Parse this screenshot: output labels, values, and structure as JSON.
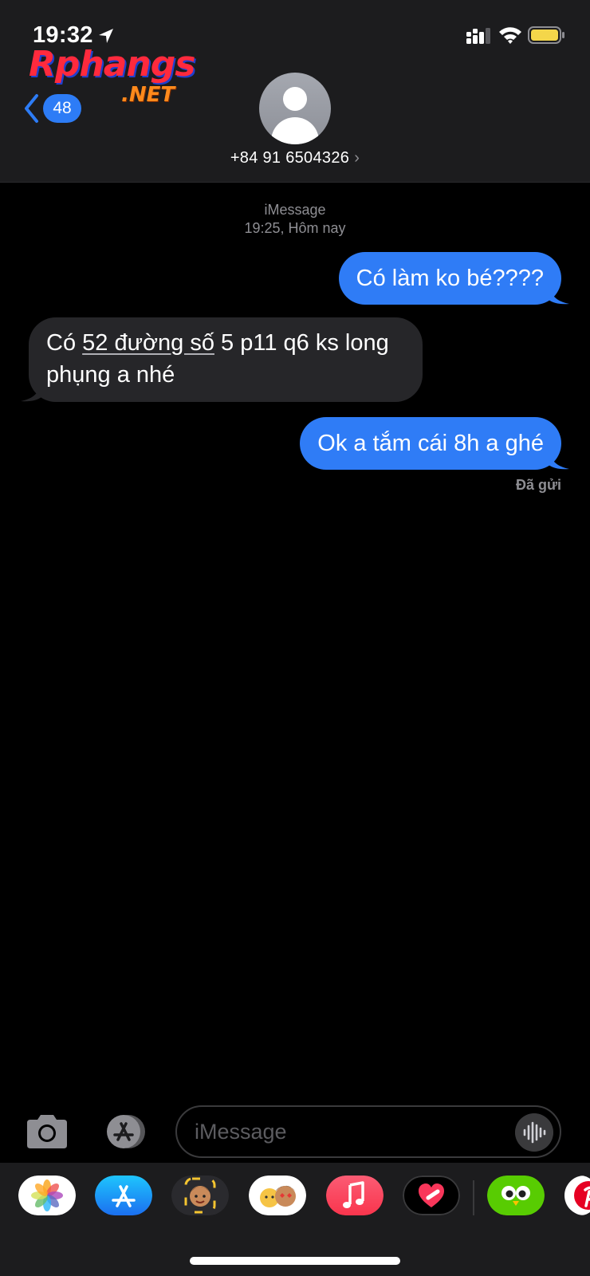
{
  "status_bar": {
    "time": "19:32"
  },
  "watermark": {
    "main": "Rphangs",
    "sub": ".NET"
  },
  "nav": {
    "back_badge": "48"
  },
  "contact": {
    "name": "+84 91 6504326",
    "chevron": "›"
  },
  "thread": {
    "service": "iMessage",
    "timestamp": "19:25, Hôm nay",
    "messages": [
      {
        "direction": "sent",
        "text": "Có làm ko bé????"
      },
      {
        "direction": "received",
        "text_before": "Có ",
        "link": "52 đường số",
        "text_after": " 5 p11 q6 ks long phụng a nhé"
      },
      {
        "direction": "sent",
        "text": "Ok a tắm cái 8h a ghé"
      }
    ],
    "delivery_status": "Đã gửi"
  },
  "composer": {
    "placeholder": "iMessage"
  },
  "app_drawer": {
    "apps": [
      "photos-icon",
      "app-store-icon",
      "memoji-stickers-icon",
      "animoji-icon",
      "music-icon",
      "digital-touch-icon",
      "duolingo-icon",
      "pinterest-icon"
    ]
  },
  "colors": {
    "sent_bubble": "#2f7cf6",
    "received_bubble": "#262629",
    "background": "#000000",
    "header": "#1c1c1e"
  }
}
